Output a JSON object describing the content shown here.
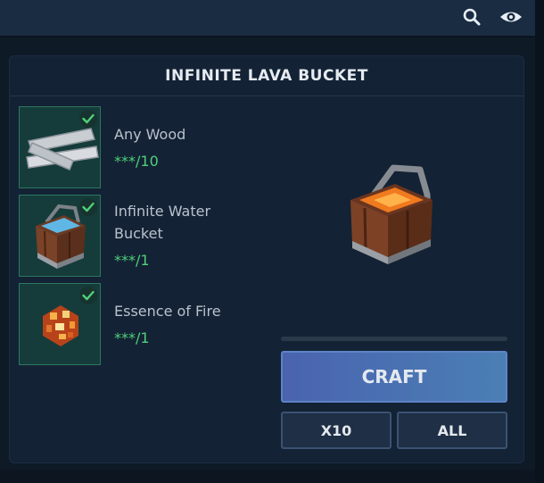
{
  "header": {
    "search_icon": "search-icon",
    "eye_icon": "eye-icon"
  },
  "recipe": {
    "title": "INFINITE LAVA BUCKET",
    "ingredients": [
      {
        "name": "Any Wood",
        "count": "***/10",
        "icon": "wood-planks-icon",
        "status": "check"
      },
      {
        "name": "Infinite Water Bucket",
        "count": "***/1",
        "icon": "water-bucket-icon",
        "status": "check"
      },
      {
        "name": "Essence of Fire",
        "count": "***/1",
        "icon": "fire-essence-icon",
        "status": "check"
      }
    ],
    "result_icon": "lava-bucket-icon",
    "progress": 0
  },
  "buttons": {
    "craft": "CRAFT",
    "x10": "X10",
    "all": "ALL"
  },
  "colors": {
    "accent": "#4a6fb2",
    "check": "#4fd17a",
    "slot_bg": "#153c3a"
  }
}
